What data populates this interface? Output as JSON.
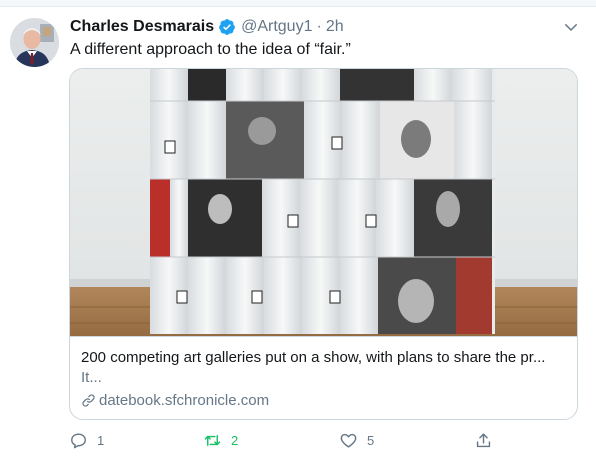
{
  "tweet": {
    "author": {
      "display_name": "Charles Desmarais",
      "handle": "@Artguy1",
      "verified": true,
      "avatar_icon": "person-photo-avatar"
    },
    "separator": "·",
    "time": "2h",
    "text": "A different approach to the idea of “fair.”",
    "menu_icon": "chevron-down-icon"
  },
  "card": {
    "image_description_icon": "toilet-paper-rolls-art-photo",
    "title": "200 competing art galleries put on a show, with plans to share the pr...",
    "description": "It...",
    "link": "datebook.sfchronicle.com",
    "link_icon": "link-icon"
  },
  "actions": {
    "reply": {
      "icon": "reply-icon",
      "count": "1"
    },
    "retweet": {
      "icon": "retweet-icon",
      "count": "2",
      "active_color": "#17bf63"
    },
    "like": {
      "icon": "heart-icon",
      "count": "5"
    },
    "share": {
      "icon": "share-icon"
    }
  },
  "colors": {
    "text_primary": "#14171a",
    "text_secondary": "#657786",
    "verified_blue": "#1da1f2",
    "border": "#ccd6dd"
  }
}
